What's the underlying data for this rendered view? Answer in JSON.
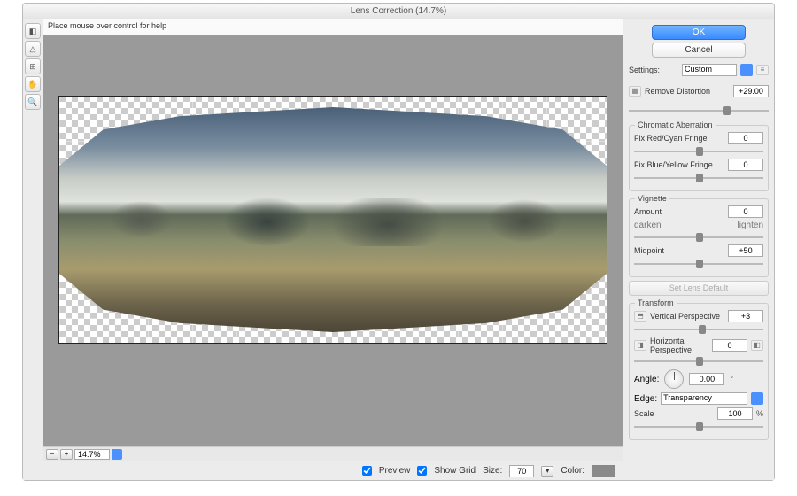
{
  "window": {
    "title": "Lens Correction (14.7%)",
    "help_hint": "Place mouse over control for help"
  },
  "buttons": {
    "ok": "OK",
    "cancel": "Cancel",
    "set_default": "Set Lens Default"
  },
  "settings": {
    "label": "Settings:",
    "value": "Custom",
    "remove_distortion_label": "Remove Distortion",
    "remove_distortion_value": "+29.00"
  },
  "chromatic": {
    "title": "Chromatic Aberration",
    "red_label": "Fix Red/Cyan Fringe",
    "red_value": "0",
    "blue_label": "Fix Blue/Yellow Fringe",
    "blue_value": "0"
  },
  "vignette": {
    "title": "Vignette",
    "amount_label": "Amount",
    "amount_value": "0",
    "darken": "darken",
    "lighten": "lighten",
    "midpoint_label": "Midpoint",
    "midpoint_value": "+50"
  },
  "transform": {
    "title": "Transform",
    "vpersp_label": "Vertical Perspective",
    "vpersp_value": "+3",
    "hpersp_label": "Horizontal Perspective",
    "hpersp_value": "0",
    "angle_label": "Angle:",
    "angle_value": "0.00",
    "angle_unit": "°",
    "edge_label": "Edge:",
    "edge_value": "Transparency",
    "scale_label": "Scale",
    "scale_value": "100",
    "scale_unit": "%"
  },
  "footer": {
    "preview_label": "Preview",
    "showgrid_label": "Show Grid",
    "size_label": "Size:",
    "size_value": "70",
    "color_label": "Color:"
  },
  "zoom": {
    "value": "14.7%"
  }
}
